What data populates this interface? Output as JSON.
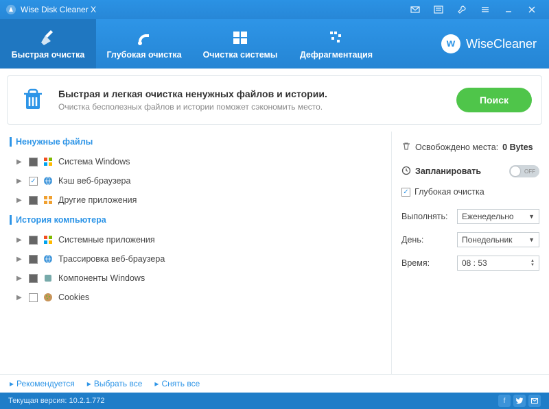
{
  "app": {
    "title": "Wise Disk Cleaner X",
    "version_label": "Текущая версия:",
    "version": "10.2.1.772"
  },
  "tabs": {
    "quick": "Быстрая очистка",
    "deep": "Глубокая очистка",
    "system": "Очистка системы",
    "defrag": "Дефрагментация"
  },
  "brand": "WiseCleaner",
  "hero": {
    "title": "Быстрая и легкая очистка ненужных файлов и истории.",
    "sub": "Очистка бесполезных файлов и истории поможет сэкономить место.",
    "search": "Поиск"
  },
  "sections": {
    "junk": {
      "title": "Ненужные файлы",
      "items": [
        "Система Windows",
        "Кэш веб-браузера",
        "Другие приложения"
      ],
      "checks": [
        "semi",
        "checked",
        "semi"
      ]
    },
    "history": {
      "title": "История компьютера",
      "items": [
        "Системные приложения",
        "Трассировка веб-браузера",
        "Компоненты Windows",
        "Cookies"
      ],
      "checks": [
        "semi",
        "semi",
        "semi",
        "none"
      ]
    }
  },
  "right": {
    "freed_label": "Освобождено места:",
    "freed_value": "0 Bytes",
    "schedule": "Запланировать",
    "toggle": "OFF",
    "deep_chk": "Глубокая очистка",
    "run_label": "Выполнять:",
    "run_value": "Еженедельно",
    "day_label": "День:",
    "day_value": "Понедельник",
    "time_label": "Время:",
    "time_value": "08 : 53"
  },
  "links": {
    "recommend": "Рекомендуется",
    "select_all": "Выбрать все",
    "deselect": "Снять все"
  }
}
